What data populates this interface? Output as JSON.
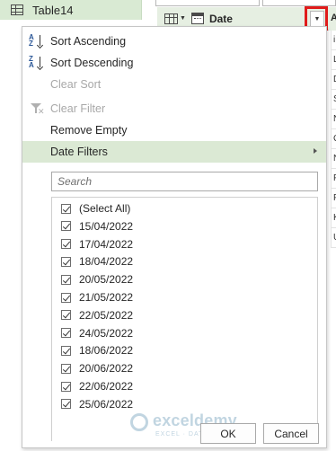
{
  "query_pane": {
    "item_label": "Table14"
  },
  "grid": {
    "column_title": "Date",
    "next_column_initial": "A",
    "partial_cells": [
      "i",
      "L",
      "D",
      "S",
      "N",
      "C",
      "N",
      "F",
      "F",
      "K",
      "U"
    ]
  },
  "menu": {
    "items": [
      {
        "label": "Sort Ascending",
        "enabled": true
      },
      {
        "label": "Sort Descending",
        "enabled": true
      },
      {
        "label": "Clear Sort",
        "enabled": false
      },
      {
        "label": "Clear Filter",
        "enabled": false
      },
      {
        "label": "Remove Empty",
        "enabled": true
      },
      {
        "label": "Date Filters",
        "enabled": true,
        "has_submenu": true,
        "highlighted": true
      }
    ],
    "search_placeholder": "Search",
    "list": [
      {
        "label": "(Select All)",
        "checked": true
      },
      {
        "label": "15/04/2022",
        "checked": true
      },
      {
        "label": "17/04/2022",
        "checked": true
      },
      {
        "label": "18/04/2022",
        "checked": true
      },
      {
        "label": "20/05/2022",
        "checked": true
      },
      {
        "label": "21/05/2022",
        "checked": true
      },
      {
        "label": "22/05/2022",
        "checked": true
      },
      {
        "label": "24/05/2022",
        "checked": true
      },
      {
        "label": "18/06/2022",
        "checked": true
      },
      {
        "label": "20/06/2022",
        "checked": true
      },
      {
        "label": "22/06/2022",
        "checked": true
      },
      {
        "label": "25/06/2022",
        "checked": true
      }
    ],
    "ok_label": "OK",
    "cancel_label": "Cancel"
  },
  "watermark": {
    "name": "exceldemy",
    "tagline": "EXCEL · DATA · BI"
  },
  "colors": {
    "accent_green": "#dbe9d4",
    "highlight_red": "#e01b1b",
    "disabled_text": "#a8a8a8"
  }
}
